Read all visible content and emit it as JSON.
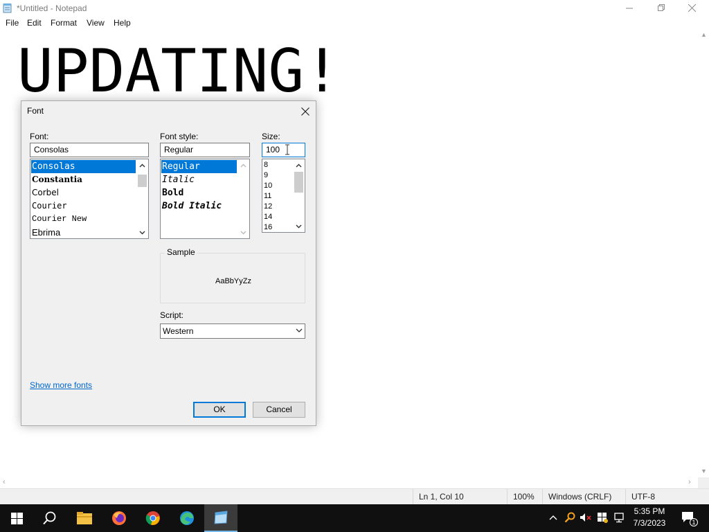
{
  "window": {
    "title": "*Untitled - Notepad",
    "menu": [
      "File",
      "Edit",
      "Format",
      "View",
      "Help"
    ]
  },
  "editor": {
    "text": "UPDATING!"
  },
  "statusbar": {
    "position": "Ln 1, Col 10",
    "zoom": "100%",
    "line_ending": "Windows (CRLF)",
    "encoding": "UTF-8"
  },
  "dialog": {
    "title": "Font",
    "font_label": "Font:",
    "font_value": "Consolas",
    "font_list": [
      "Consolas",
      "Constantia",
      "Corbel",
      "Courier",
      "Courier New",
      "Ebrima"
    ],
    "style_label": "Font style:",
    "style_value": "Regular",
    "style_list": [
      "Regular",
      "Italic",
      "Bold",
      "Bold Italic"
    ],
    "size_label": "Size:",
    "size_value": "100",
    "size_list": [
      "8",
      "9",
      "10",
      "11",
      "12",
      "14",
      "16"
    ],
    "sample_label": "Sample",
    "sample_text": "AaBbYyZz",
    "script_label": "Script:",
    "script_value": "Western",
    "more_fonts": "Show more fonts",
    "ok": "OK",
    "cancel": "Cancel"
  },
  "taskbar": {
    "time": "5:35 PM",
    "date": "7/3/2023",
    "notification_count": "1",
    "apps": [
      "start-icon",
      "search-icon",
      "file-explorer-icon",
      "firefox-icon",
      "chrome-icon",
      "edge-icon",
      "notepad-icon"
    ]
  },
  "colors": {
    "selection": "#0078d7",
    "link": "#0066cc",
    "taskbar": "#101010"
  }
}
